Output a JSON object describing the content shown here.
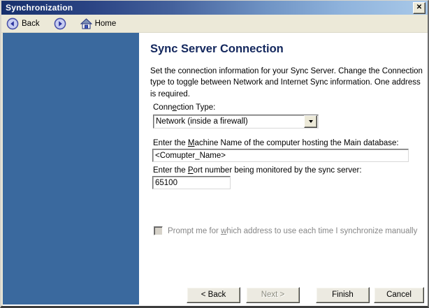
{
  "window": {
    "title": "Synchronization"
  },
  "icons": {
    "close": "✕"
  },
  "toolbar": {
    "back_label": "Back",
    "home_label": "Home"
  },
  "content": {
    "heading": "Sync Server Connection",
    "description": "Set the connection information for your Sync Server. Change the Connection type to toggle between Network and Internet Sync information. One address is required.",
    "connection_type_label": {
      "pre": "Conn",
      "mnemonic": "e",
      "post": "ction Type:"
    },
    "connection_type_value": "Network (inside a firewall)",
    "machine_label": {
      "pre": "Enter the ",
      "mnemonic": "M",
      "post": "achine Name of the computer hosting the Main database:"
    },
    "machine_value": "<Comupter_Name>",
    "port_label": {
      "pre": "Enter the ",
      "mnemonic": "P",
      "post": "ort number being monitored by the sync server:"
    },
    "port_value": "65100",
    "prompt_checkbox": {
      "pre": "Prompt me for ",
      "mnemonic": "w",
      "post": "hich address to use each time I synchronize manually",
      "checked": "false",
      "enabled": "false"
    }
  },
  "buttons": {
    "back": "< Back",
    "next": "Next >",
    "next_enabled": "false",
    "finish": "Finish",
    "cancel": "Cancel"
  },
  "colors": {
    "sidebar": "#3a699e",
    "heading": "#13275d",
    "titlebar_left": "#17306c",
    "titlebar_right": "#a9c9e9",
    "toolbar_bg": "#ece9d8"
  }
}
